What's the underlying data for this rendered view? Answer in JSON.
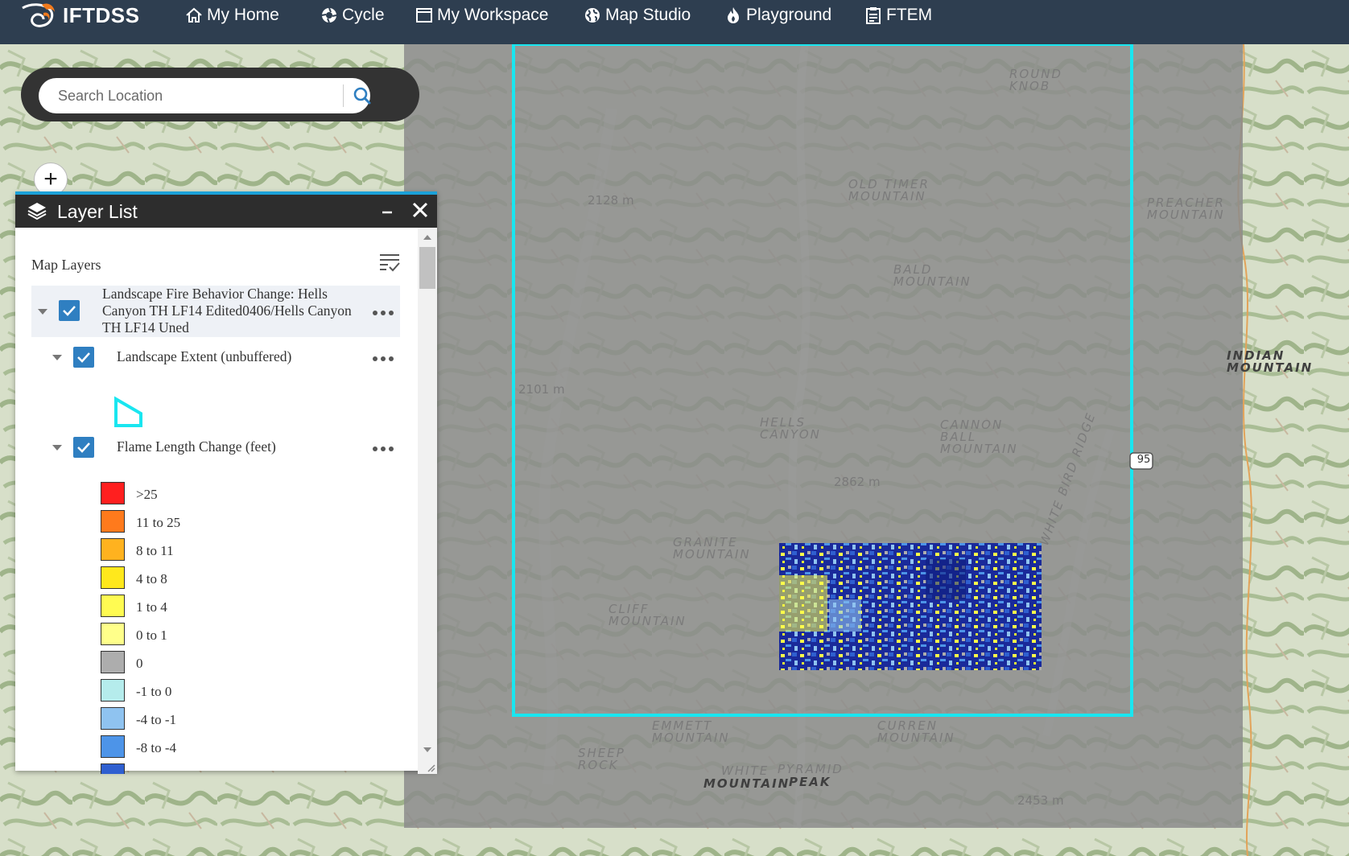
{
  "app": {
    "logo_text": "IFTDSS"
  },
  "nav": {
    "items": [
      {
        "label": "My Home",
        "icon": "home-icon"
      },
      {
        "label": "Cycle",
        "icon": "cycle-icon"
      },
      {
        "label": "My Workspace",
        "icon": "workspace-icon"
      },
      {
        "label": "Map Studio",
        "icon": "globe-icon"
      },
      {
        "label": "Playground",
        "icon": "flame-icon"
      },
      {
        "label": "FTEM",
        "icon": "clipboard-icon"
      }
    ]
  },
  "search": {
    "placeholder": "Search Location",
    "icon": "search-icon"
  },
  "zoom": {
    "in_label": "+"
  },
  "layer_panel": {
    "title": "Layer List",
    "heading": "Map Layers",
    "layers": [
      {
        "title_lines": [
          "Landscape Fire Behavior Change: Hells",
          "Canyon TH LF14 Edited0406/Hells Canyon",
          "TH LF14 Uned"
        ],
        "checked": true
      },
      {
        "title": "Landscape Extent (unbuffered)",
        "checked": true,
        "symbol_color": "#00e5ee"
      },
      {
        "title": "Flame Length Change (feet)",
        "checked": true
      }
    ],
    "legend": [
      {
        "label": ">25",
        "color": "#ff1f1f"
      },
      {
        "label": "11 to 25",
        "color": "#ff7a1c"
      },
      {
        "label": "8 to 11",
        "color": "#ffb21f"
      },
      {
        "label": "4 to 8",
        "color": "#ffe81c"
      },
      {
        "label": "1 to 4",
        "color": "#fffb52"
      },
      {
        "label": "0 to 1",
        "color": "#ffff8a"
      },
      {
        "label": "0",
        "color": "#adadad"
      },
      {
        "label": "-1 to 0",
        "color": "#b5ecec"
      },
      {
        "label": "-4 to -1",
        "color": "#8fc3f0"
      },
      {
        "label": "-8 to -4",
        "color": "#4d94e8"
      },
      {
        "label": "",
        "color": "#2f5fd0"
      }
    ]
  },
  "map": {
    "extent_color": "#19e6f0",
    "labels": [
      {
        "text": "ROUND\nKNOB"
      },
      {
        "text": "OLD TIMER\nMOUNTAIN"
      },
      {
        "text": "PREACHER\nMOUNTAIN"
      },
      {
        "text": "BALD\nMOUNTAIN"
      },
      {
        "text": "HELLS\nCANYON"
      },
      {
        "text": "CANNON\nBALL\nMOUNTAIN"
      },
      {
        "text": "INDIAN\nMOUNTAIN"
      },
      {
        "text": "GRANITE\nMOUNTAIN"
      },
      {
        "text": "CLIFF\nMOUNTAIN"
      },
      {
        "text": "EMMETT\nMOUNTAIN"
      },
      {
        "text": "SHEEP\nROCK"
      },
      {
        "text": "CURREN\nMOUNTAIN"
      },
      {
        "text": "WHITE BIRD RIDGE"
      },
      {
        "text": "MOUNTAIN"
      },
      {
        "text": "PEAK"
      },
      {
        "text": "WHITE"
      },
      {
        "text": "PYRAMID"
      }
    ],
    "elevations": [
      "2128 m",
      "2101 m",
      "2862 m",
      "2453 m"
    ],
    "route_shield": "95"
  }
}
